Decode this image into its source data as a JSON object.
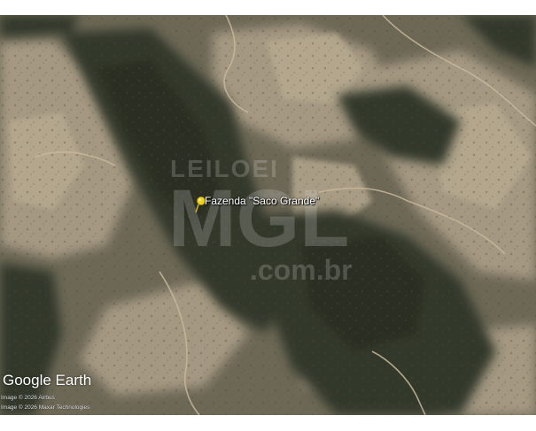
{
  "placemark": {
    "label": "Fazenda \"Saco Grande\"",
    "icon": "yellow-pushpin-icon",
    "color": "#f2d21b"
  },
  "watermark": {
    "line1": "LEILOEI",
    "line2": "MGL",
    "line3": ".com.br"
  },
  "branding": {
    "logo_text": "Google Earth",
    "credits": [
      "Image © 2026 Airbus",
      "Image © 2026 Maxar Technologies"
    ]
  },
  "colors": {
    "forest": "#3a3e2f",
    "pasture": "#9d917a",
    "road": "#c9b79a"
  }
}
